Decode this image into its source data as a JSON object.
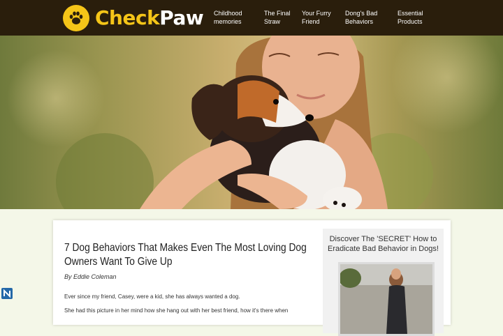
{
  "brand": {
    "part1": "Check",
    "part2": "Paw"
  },
  "nav": [
    {
      "line1": "Childhood",
      "line2": "memories"
    },
    {
      "line1": "The Final",
      "line2": "Straw"
    },
    {
      "line1": "Your Furry",
      "line2": "Friend"
    },
    {
      "line1": "Dong's Bad",
      "line2": "Behaviors"
    },
    {
      "line1": "Essential",
      "line2": "Products"
    }
  ],
  "article": {
    "title": "7 Dog Behaviors That Makes Even The Most Loving Dog Owners Want To Give Up",
    "byline": "By Eddie Coleman",
    "p1": "Ever since my friend, Casey, were a kid, she has always wanted a dog.",
    "p2": "She had this picture in her mind how she hang out with her best friend, how it's there when"
  },
  "sidebar": {
    "title": "Discover The 'SECRET' How to Eradicate Bad Behavior in Dogs!"
  },
  "colors": {
    "header": "#2a1e0c",
    "brand_yellow": "#f5c518",
    "page_bg": "#f4f7e8"
  }
}
